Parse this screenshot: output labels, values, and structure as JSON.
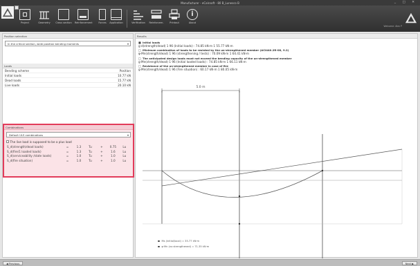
{
  "window": {
    "title": "Manufacturer - eCalcsoft - 80 B_Lunesco B",
    "controls": "_ □ ✕"
  },
  "ribbon": {
    "tools": [
      {
        "label": "Project",
        "icon": "project-icon"
      },
      {
        "label": "Geometry",
        "icon": "geometry-icon"
      },
      {
        "label": "Cross section",
        "icon": "cross-section-icon"
      },
      {
        "label": "Reinforcement",
        "icon": "reinforcement-icon"
      },
      {
        "label": "Forces",
        "icon": "forces-icon"
      },
      {
        "label": "Application",
        "icon": "application-icon"
      },
      {
        "label": "Verification",
        "icon": "verification-icon"
      },
      {
        "label": "Reinforcem.",
        "icon": "reinforcement-list-icon"
      },
      {
        "label": "Printout",
        "icon": "printer-icon"
      },
      {
        "label": "About",
        "icon": "info-icon"
      }
    ],
    "engineer": "Welcome: Alex P"
  },
  "left": {
    "position_header": "Position selection",
    "position_value": "In the critical section, wide position bending moments",
    "loads_header": "Loads",
    "loads_cols": [
      "Bending scheme",
      "Position"
    ],
    "loads": [
      {
        "name": "Initial loads",
        "value": "10.77 kN"
      },
      {
        "name": "Dead loads",
        "value": "15.77 kN"
      },
      {
        "name": "Live loads",
        "value": "20.10 kN"
      }
    ],
    "combo_header": "Combinations",
    "combo_select": "Default ULS combinations",
    "combo_check": "The live load is supposed to be a plus load",
    "combo_rows": [
      {
        "name": "S_d(strength/dead loads)",
        "op": "=",
        "f1": "1.3",
        "sym": "Tu",
        "plus": "+",
        "f2": "0.75",
        "s2": "Lu"
      },
      {
        "name": "S_d(fire/1 loaded loads)",
        "op": "=",
        "f1": "1.3",
        "sym": "Tu",
        "plus": "+",
        "f2": "1.6",
        "s2": "Lu"
      },
      {
        "name": "S_d(serviceability /state loads)",
        "op": "=",
        "f1": "1.0",
        "sym": "Tu",
        "plus": "+",
        "f2": "1.0",
        "s2": "Lu"
      },
      {
        "name": "S_d(fire situation)",
        "op": "=",
        "f1": "1.0",
        "sym": "Tu",
        "plus": "+",
        "f2": "1.0",
        "s2": "Lu"
      }
    ]
  },
  "results": {
    "header": "Results",
    "items": [
      {
        "mark": "■",
        "title": "Initial loads",
        "sub": "g·d(strength/dead) 1 96 (Initial loads) : 74.85 kN·m 1 55.77 kN·m"
      },
      {
        "mark": "□",
        "title": "Minimum combination of loads to be resisted by the un-strengthened member (ACI440.2R-08, 9.2)",
        "sub": "φ·Mn(strength/dead) 1 96 (strengthening / tests) : 70.09 kN·m 1 64.41 kN·m"
      },
      {
        "mark": "□",
        "title": "The anticipated design loads must not exceed the bending capacity of the un-strengthened member",
        "sub": "g·Mn(strength/dead) 1 96 (Initial loaded loads) : 74.85 kN·m 1 66.11 kN·m"
      },
      {
        "mark": "□",
        "title": "Resistance of the un-strengthened member in case of fire",
        "sub": "g·Mn(strength/dead) 1 96 (Fire situation) : 60.17 kN·m 1 80.05 kN·m"
      }
    ],
    "span_label": "5.0 m",
    "legend": [
      {
        "text": "Ms (initial/local) = 35.77 kN·m"
      },
      {
        "text": "φ·Mn (no strengthened) = 71.35 kN·m"
      }
    ]
  },
  "bottom": {
    "previous": "◀ Previous",
    "next": "Next ▶"
  },
  "colors": {
    "highlight_border": "#e23b5a",
    "highlight_fill": "#fbe3e7",
    "ribbon": "#3a3a3a"
  }
}
